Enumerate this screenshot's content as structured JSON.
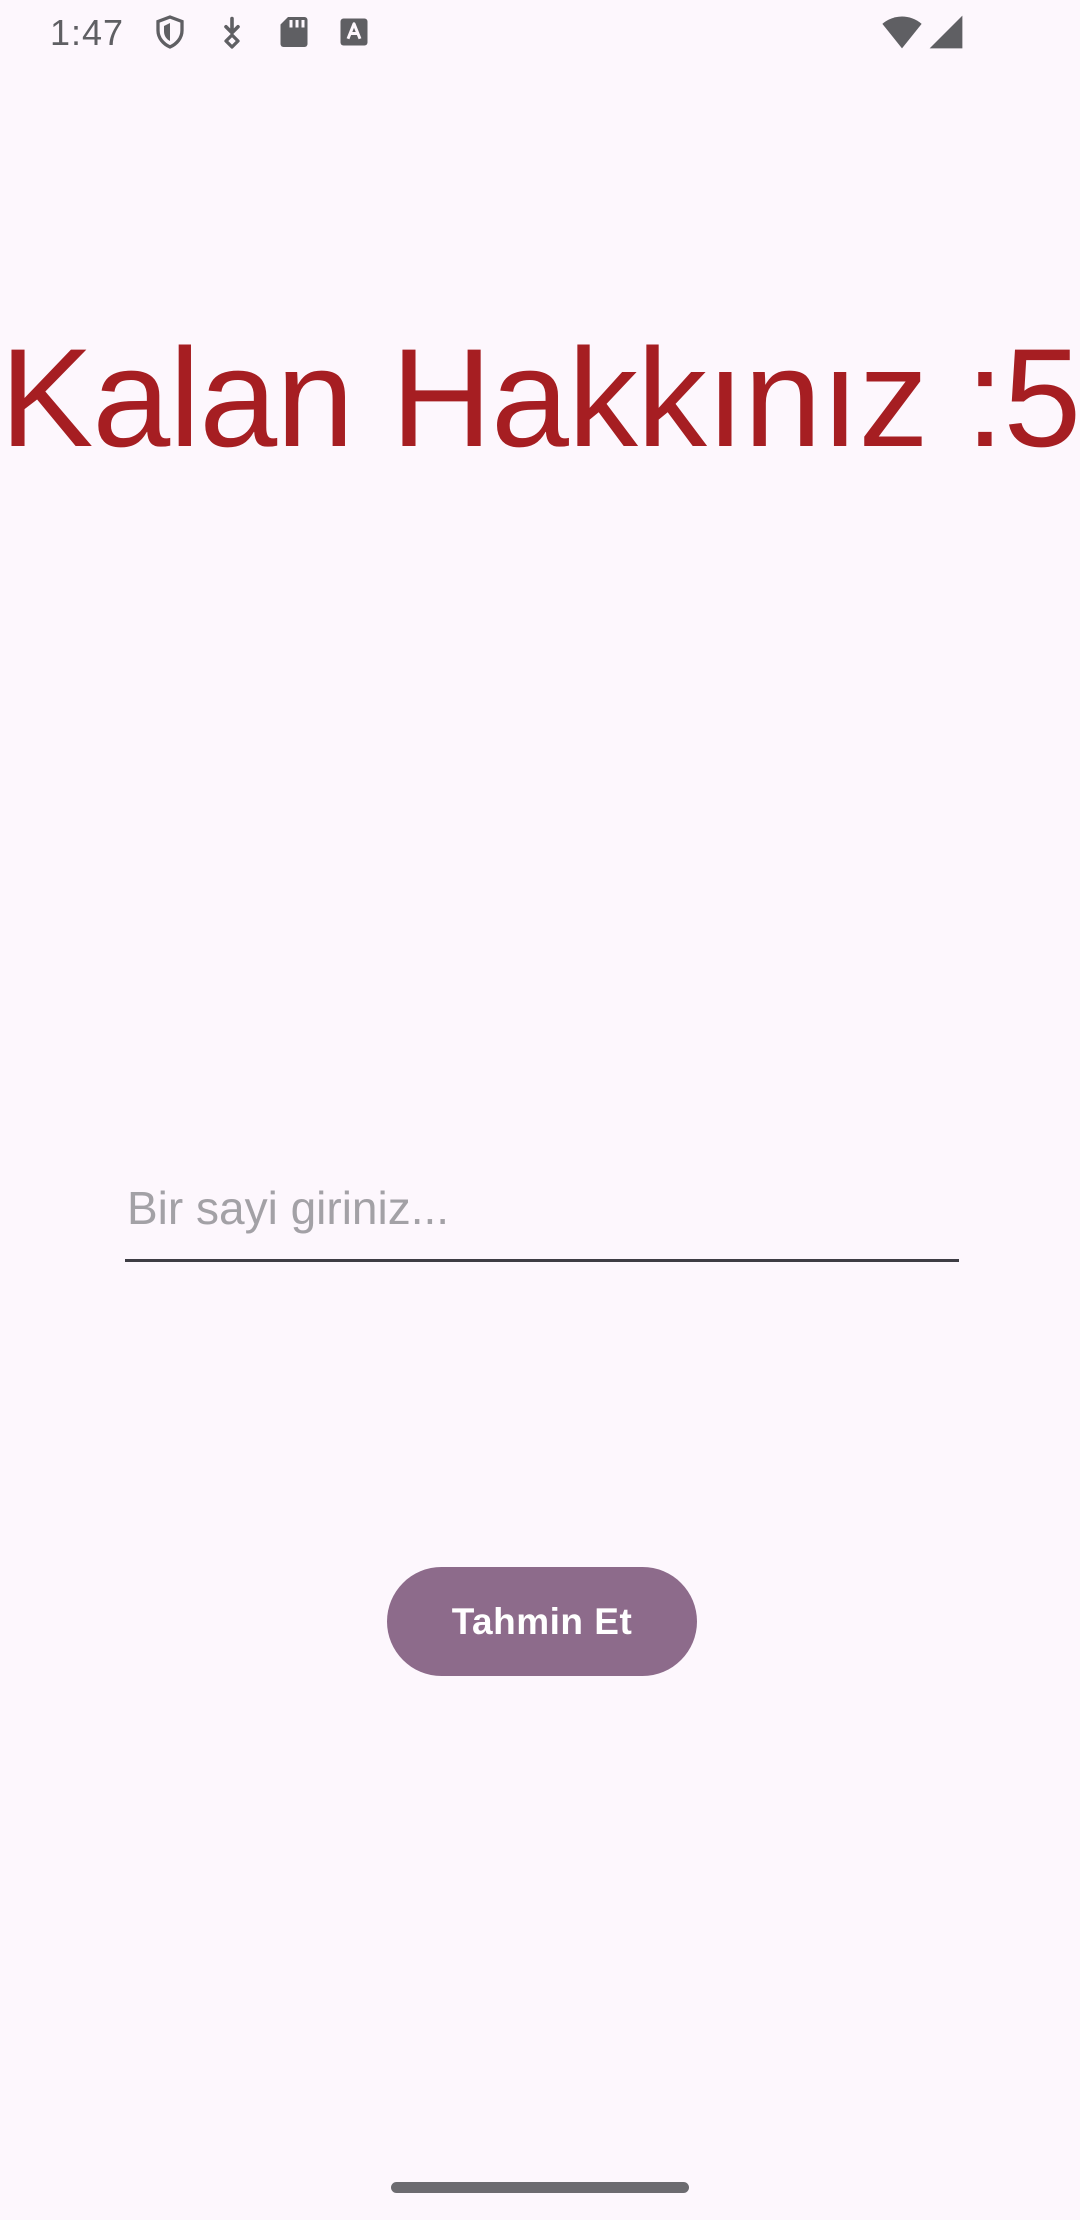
{
  "status_bar": {
    "time": "1:47",
    "icons": [
      "shield-icon",
      "download-icon",
      "sd-card-icon",
      "font-icon",
      "wifi-icon",
      "signal-icon"
    ]
  },
  "game": {
    "remaining_text": "Kalan Hakkınız :5",
    "input_placeholder": "Bir sayi giriniz...",
    "input_value": "",
    "button_label": "Tahmin Et"
  },
  "colors": {
    "background": "#fdf7fd",
    "title_red": "#a61e22",
    "button_purple": "#8d6b8b",
    "status_gray": "#5f5f63"
  }
}
